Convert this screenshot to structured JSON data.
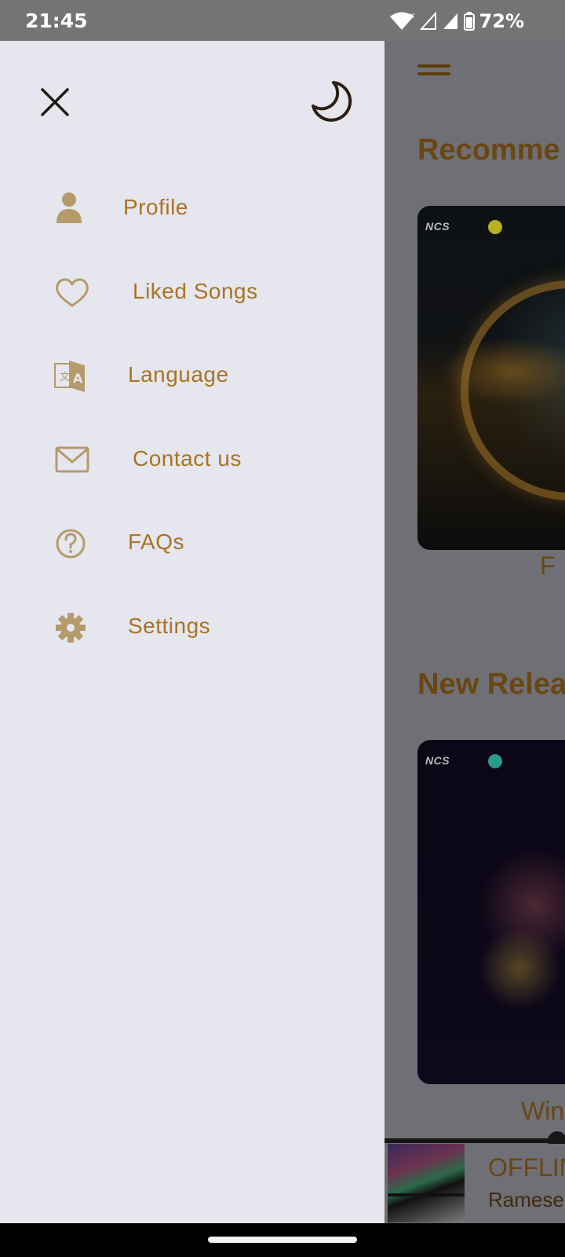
{
  "status_bar": {
    "time": "21:45",
    "battery_percent": "72%",
    "icons": [
      "wifi-icon",
      "signal-icon",
      "battery-icon"
    ]
  },
  "drawer": {
    "close_icon": "close-icon",
    "theme_icon": "moon-icon",
    "items": [
      {
        "label": "Profile",
        "icon": "person-icon"
      },
      {
        "label": "Liked Songs",
        "icon": "heart-icon"
      },
      {
        "label": "Language",
        "icon": "translate-icon"
      },
      {
        "label": "Contact us",
        "icon": "mail-icon"
      },
      {
        "label": "FAQs",
        "icon": "help-icon"
      },
      {
        "label": "Settings",
        "icon": "gear-icon"
      }
    ]
  },
  "background": {
    "section_recommended": "Recomme",
    "recommended_caption": "F",
    "section_new": "New Relea",
    "new_caption": "Win",
    "card_badge": "NCS"
  },
  "mini_player": {
    "title": "OFFLIN",
    "artist": "Ramese"
  },
  "colors": {
    "accent": "#a87423",
    "drawer_bg": "#e6e6ee",
    "overlay": "#6f7075",
    "icon_tan": "#b59a6c"
  }
}
